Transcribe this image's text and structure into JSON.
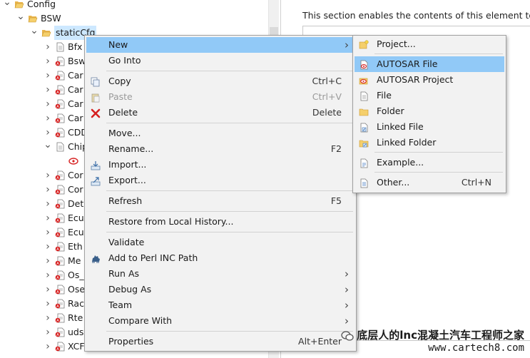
{
  "tree": {
    "items": [
      {
        "label": "Config",
        "expanded": true,
        "icon": "folder-open-icon"
      },
      {
        "label": "BSW",
        "expanded": true,
        "icon": "folder-open-icon"
      },
      {
        "label": "staticCfg",
        "expanded": true,
        "icon": "folder-open-icon",
        "selected": true
      },
      {
        "label": "Bfx",
        "icon": "file-icon"
      },
      {
        "label": "Bsw",
        "icon": "file-warn-icon"
      },
      {
        "label": "Car",
        "icon": "file-warn-icon"
      },
      {
        "label": "Car",
        "icon": "file-warn-icon"
      },
      {
        "label": "Car",
        "icon": "file-warn-icon"
      },
      {
        "label": "Car",
        "icon": "file-warn-icon"
      },
      {
        "label": "CDD",
        "icon": "file-warn-icon"
      },
      {
        "label": "Chip",
        "expanded": true,
        "icon": "file-icon"
      },
      {
        "label": "",
        "icon": "autosar-element-icon"
      },
      {
        "label": "Cor",
        "icon": "file-warn-icon"
      },
      {
        "label": "Cor",
        "icon": "file-warn-icon"
      },
      {
        "label": "Det",
        "icon": "file-warn-icon"
      },
      {
        "label": "Ecu",
        "icon": "file-warn-icon"
      },
      {
        "label": "Ecu",
        "icon": "file-warn-icon"
      },
      {
        "label": "Eth",
        "icon": "file-warn-icon"
      },
      {
        "label": "Me",
        "icon": "file-warn-icon"
      },
      {
        "label": "Os_",
        "icon": "file-warn-icon"
      },
      {
        "label": "Ose",
        "icon": "file-warn-icon"
      },
      {
        "label": "Rac",
        "icon": "file-warn-icon"
      },
      {
        "label": "Rte",
        "icon": "file-warn-icon"
      },
      {
        "label": "uds",
        "icon": "file-warn-icon"
      },
      {
        "label": "XCF",
        "icon": "file-warn-icon"
      }
    ]
  },
  "right_pane": {
    "description": "This section enables the contents of this element to be"
  },
  "context_menu": {
    "groups": [
      [
        {
          "label": "New",
          "submenu": true,
          "highlighted": true
        },
        {
          "label": "Go Into"
        }
      ],
      [
        {
          "label": "Copy",
          "accel": "Ctrl+C",
          "icon": "copy-icon"
        },
        {
          "label": "Paste",
          "accel": "Ctrl+V",
          "icon": "paste-icon",
          "disabled": true
        },
        {
          "label": "Delete",
          "accel": "Delete",
          "icon": "delete-x-icon"
        }
      ],
      [
        {
          "label": "Move..."
        },
        {
          "label": "Rename...",
          "accel": "F2"
        },
        {
          "label": "Import...",
          "icon": "import-icon"
        },
        {
          "label": "Export...",
          "icon": "export-icon"
        }
      ],
      [
        {
          "label": "Refresh",
          "accel": "F5"
        }
      ],
      [
        {
          "label": "Restore from Local History..."
        }
      ],
      [
        {
          "label": "Validate"
        },
        {
          "label": "Add to Perl INC Path",
          "icon": "perl-camel-icon"
        },
        {
          "label": "Run As",
          "submenu": true
        },
        {
          "label": "Debug As",
          "submenu": true
        },
        {
          "label": "Team",
          "submenu": true
        },
        {
          "label": "Compare With",
          "submenu": true
        }
      ],
      [
        {
          "label": "Properties",
          "accel": "Alt+Enter"
        }
      ]
    ]
  },
  "submenu_new": {
    "groups": [
      [
        {
          "label": "Project...",
          "icon": "project-icon"
        }
      ],
      [
        {
          "label": "AUTOSAR File",
          "icon": "autosar-file-icon",
          "highlighted": true
        },
        {
          "label": "AUTOSAR Project",
          "icon": "autosar-project-icon"
        },
        {
          "label": "File",
          "icon": "file-icon"
        },
        {
          "label": "Folder",
          "icon": "folder-icon"
        },
        {
          "label": "Linked File",
          "icon": "linked-file-icon"
        },
        {
          "label": "Linked Folder",
          "icon": "linked-folder-icon"
        }
      ],
      [
        {
          "label": "Example...",
          "icon": "example-icon"
        }
      ],
      [
        {
          "label": "Other...",
          "accel": "Ctrl+N",
          "icon": "other-icon"
        }
      ]
    ]
  },
  "watermark": {
    "line1": "底层人的lnc混凝土汽车工程师之家",
    "line2": "www.cartech8.com"
  },
  "colors": {
    "menu_highlight": "#91c9f7",
    "tree_selection": "#cde8ff",
    "menu_background": "#f2f2f2"
  }
}
